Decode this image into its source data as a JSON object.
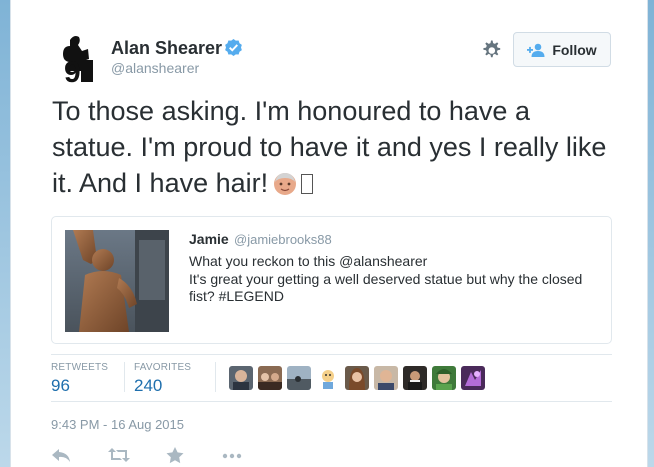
{
  "tweet": {
    "author_name": "Alan Shearer",
    "author_handle": "@alanshearer",
    "verified": true,
    "text": "To those asking. I'm honoured to have a statue. I'm proud to have it and yes I really like it. And I have hair!",
    "emoji": "older-man-emoji",
    "timestamp": "9:43 PM - 16 Aug 2015"
  },
  "header_actions": {
    "follow_label": "Follow",
    "settings_icon": "gear-icon",
    "follow_icon": "add-user-icon"
  },
  "quoted_tweet": {
    "author_name": "Jamie",
    "author_handle": "@jamiebrooks88",
    "text": "What you reckon to this @alanshearer\n It's great your getting a well deserved statue but why the closed fist? #LEGEND"
  },
  "stats": {
    "retweets_label": "RETWEETS",
    "retweets_count": "96",
    "favorites_label": "FAVORITES",
    "favorites_count": "240"
  },
  "favoriters_count_shown": 9,
  "actions": [
    "reply-icon",
    "retweet-icon",
    "favorite-icon",
    "more-icon"
  ],
  "colors": {
    "link": "#1f6fad",
    "verified": "#55acee",
    "muted": "#8899a6",
    "text": "#292f33"
  }
}
